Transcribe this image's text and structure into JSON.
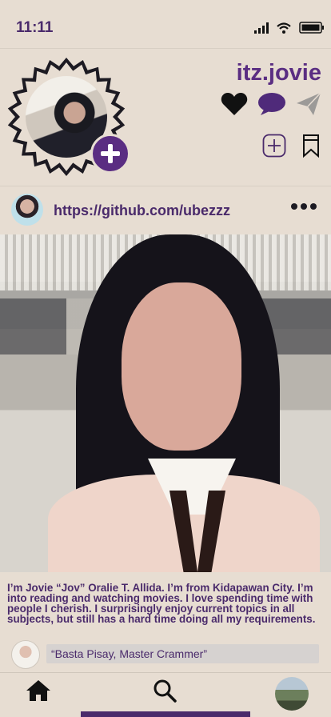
{
  "status_bar": {
    "time": "11:11"
  },
  "profile": {
    "username": "itz.jovie"
  },
  "post": {
    "link": "https://github.com/ubezzz",
    "bio": "I’m Jovie “Jov” Oralie T. Allida. I’m from Kidapawan City. I’m into reading and watching movies. I love spending time with people I cherish. I surprisingly enjoy current topics in all subjects, but still has a hard time doing all my requirements.",
    "comment": "“Basta Pisay, Master Crammer”"
  },
  "colors": {
    "background": "#e7ddd2",
    "accent": "#5a2d82",
    "text": "#4a2a6b"
  },
  "icons": [
    "signal-icon",
    "wifi-icon",
    "battery-icon",
    "heart-icon",
    "comment-icon",
    "send-icon",
    "add-post-icon",
    "bookmark-icon",
    "more-icon",
    "home-icon",
    "search-icon"
  ]
}
